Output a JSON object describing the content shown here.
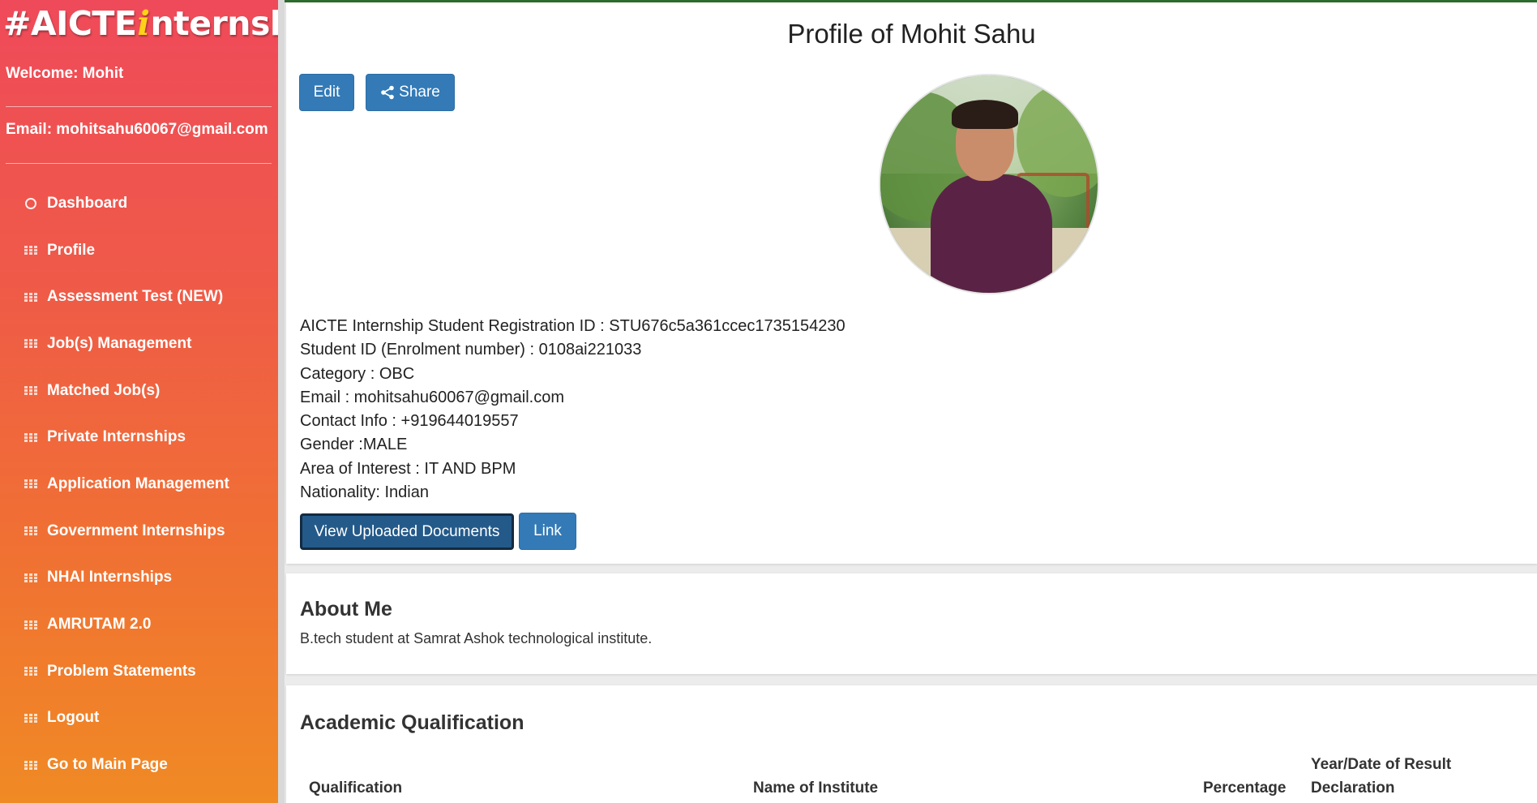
{
  "sidebar": {
    "logo": {
      "prefix": "#AICTE",
      "i_letter": "i",
      "suffix": "nternship"
    },
    "welcome": "Welcome: Mohit",
    "email": "Email: mohitsahu60067@gmail.com",
    "items": [
      {
        "label": "Dashboard",
        "icon": "circle-icon"
      },
      {
        "label": "Profile",
        "icon": "grid-icon"
      },
      {
        "label": "Assessment Test (NEW)",
        "icon": "grid-icon"
      },
      {
        "label": "Job(s) Management",
        "icon": "grid-icon"
      },
      {
        "label": "Matched Job(s)",
        "icon": "grid-icon"
      },
      {
        "label": "Private Internships",
        "icon": "grid-icon"
      },
      {
        "label": "Application Management",
        "icon": "grid-icon"
      },
      {
        "label": "Government Internships",
        "icon": "grid-icon"
      },
      {
        "label": "NHAI Internships",
        "icon": "grid-icon"
      },
      {
        "label": "AMRUTAM 2.0",
        "icon": "grid-icon"
      },
      {
        "label": "Problem Statements",
        "icon": "grid-icon"
      },
      {
        "label": "Logout",
        "icon": "grid-icon"
      },
      {
        "label": "Go to Main Page",
        "icon": "grid-icon"
      }
    ]
  },
  "profile": {
    "title": "Profile of Mohit Sahu",
    "edit_label": "Edit",
    "share_label": "Share",
    "info": [
      "AICTE Internship Student Registration ID : STU676c5a361ccec1735154230",
      "Student ID (Enrolment number) : 0108ai221033",
      "Category : OBC",
      "Email : mohitsahu60067@gmail.com",
      "Contact Info : +919644019557",
      "Gender :MALE",
      "Area of Interest : IT AND BPM",
      "Nationality: Indian"
    ],
    "view_docs_label": "View Uploaded Documents",
    "link_label": "Link"
  },
  "about": {
    "title": "About Me",
    "text": "B.tech student at Samrat Ashok technological institute."
  },
  "academic": {
    "title": "Academic Qualification",
    "headers": [
      "Qualification",
      "Name of Institute",
      "Percentage",
      "Year/Date of Result",
      "Declaration"
    ]
  },
  "colors": {
    "primary_button": "#337ab7",
    "sidebar_top": "#ef4a5a",
    "sidebar_bottom": "#f08a24"
  }
}
